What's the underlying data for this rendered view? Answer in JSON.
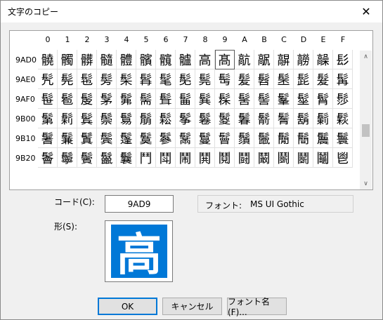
{
  "window": {
    "title": "文字のコピー",
    "close_symbol": "✕"
  },
  "grid": {
    "columns": [
      "0",
      "1",
      "2",
      "3",
      "4",
      "5",
      "6",
      "7",
      "8",
      "9",
      "A",
      "B",
      "C",
      "D",
      "E",
      "F"
    ],
    "rows": [
      {
        "label": "9AD0",
        "chars": [
          "髐",
          "髑",
          "髒",
          "髓",
          "體",
          "髕",
          "髖",
          "髗",
          "高",
          "髙",
          "髚",
          "髛",
          "髜",
          "髝",
          "髞",
          "髟"
        ]
      },
      {
        "label": "9AE0",
        "chars": [
          "髠",
          "髡",
          "髢",
          "髣",
          "髤",
          "髥",
          "髦",
          "髧",
          "髨",
          "髩",
          "髪",
          "髫",
          "髬",
          "髭",
          "髮",
          "髯"
        ]
      },
      {
        "label": "9AF0",
        "chars": [
          "髰",
          "髱",
          "髲",
          "髳",
          "髴",
          "髵",
          "髶",
          "髷",
          "髸",
          "髹",
          "髺",
          "髻",
          "髼",
          "髽",
          "髾",
          "髿"
        ]
      },
      {
        "label": "9B00",
        "chars": [
          "鬀",
          "鬁",
          "鬂",
          "鬃",
          "鬄",
          "鬅",
          "鬆",
          "鬇",
          "鬈",
          "鬉",
          "鬊",
          "鬋",
          "鬌",
          "鬍",
          "鬎",
          "鬏"
        ]
      },
      {
        "label": "9B10",
        "chars": [
          "鬐",
          "鬑",
          "鬒",
          "鬓",
          "鬔",
          "鬕",
          "鬖",
          "鬗",
          "鬘",
          "鬙",
          "鬚",
          "鬛",
          "鬜",
          "鬝",
          "鬞",
          "鬟"
        ]
      },
      {
        "label": "9B20",
        "chars": [
          "鬠",
          "鬡",
          "鬢",
          "鬣",
          "鬤",
          "鬥",
          "鬦",
          "鬧",
          "鬨",
          "鬩",
          "鬪",
          "鬫",
          "鬬",
          "鬭",
          "鬮",
          "鬯"
        ]
      }
    ],
    "selected_char": "髙"
  },
  "scrollbar": {
    "up_arrow": "∧",
    "down_arrow": "∨"
  },
  "code": {
    "label": "コード(C):",
    "value": "9AD9"
  },
  "font": {
    "label": "フォント:",
    "value": "MS UI Gothic"
  },
  "shape": {
    "label": "形(S):",
    "preview_char": "高"
  },
  "buttons": {
    "ok": "OK",
    "cancel": "キャンセル",
    "font_name": "フォント名(F)..."
  },
  "colors": {
    "accent": "#0078d7"
  }
}
